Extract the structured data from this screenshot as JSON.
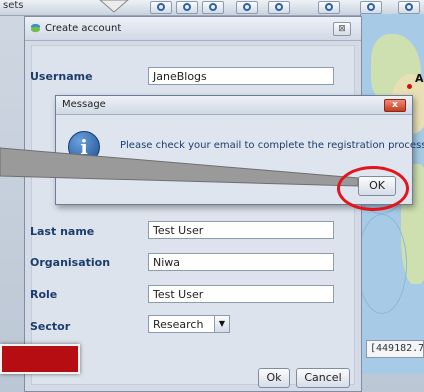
{
  "app": {
    "top_label": "sets",
    "coordinate_readout": "[449182.7"
  },
  "map": {
    "label": "A"
  },
  "create_account": {
    "title": "Create account",
    "close_glyph": "⊠",
    "fields": {
      "username": {
        "label": "Username",
        "value": "JaneBlogs"
      },
      "last_name": {
        "label": "Last name",
        "value": "Test User"
      },
      "organisation": {
        "label": "Organisation",
        "value": "Niwa"
      },
      "role": {
        "label": "Role",
        "value": "Test User"
      },
      "sector": {
        "label": "Sector",
        "value": "Research"
      }
    },
    "ok_label": "Ok",
    "cancel_label": "Cancel"
  },
  "message": {
    "title": "Message",
    "close_glyph": "x",
    "info_glyph": "i",
    "text": "Please check your email to complete the registration process.",
    "ok_label": "OK"
  },
  "icons": [
    "search-icon",
    "info-icon",
    "close-icon",
    "dropdown-arrow-icon",
    "app-logo-icon"
  ],
  "colors": {
    "highlight": "#e3141b",
    "label_blue": "#1c3d6b"
  }
}
